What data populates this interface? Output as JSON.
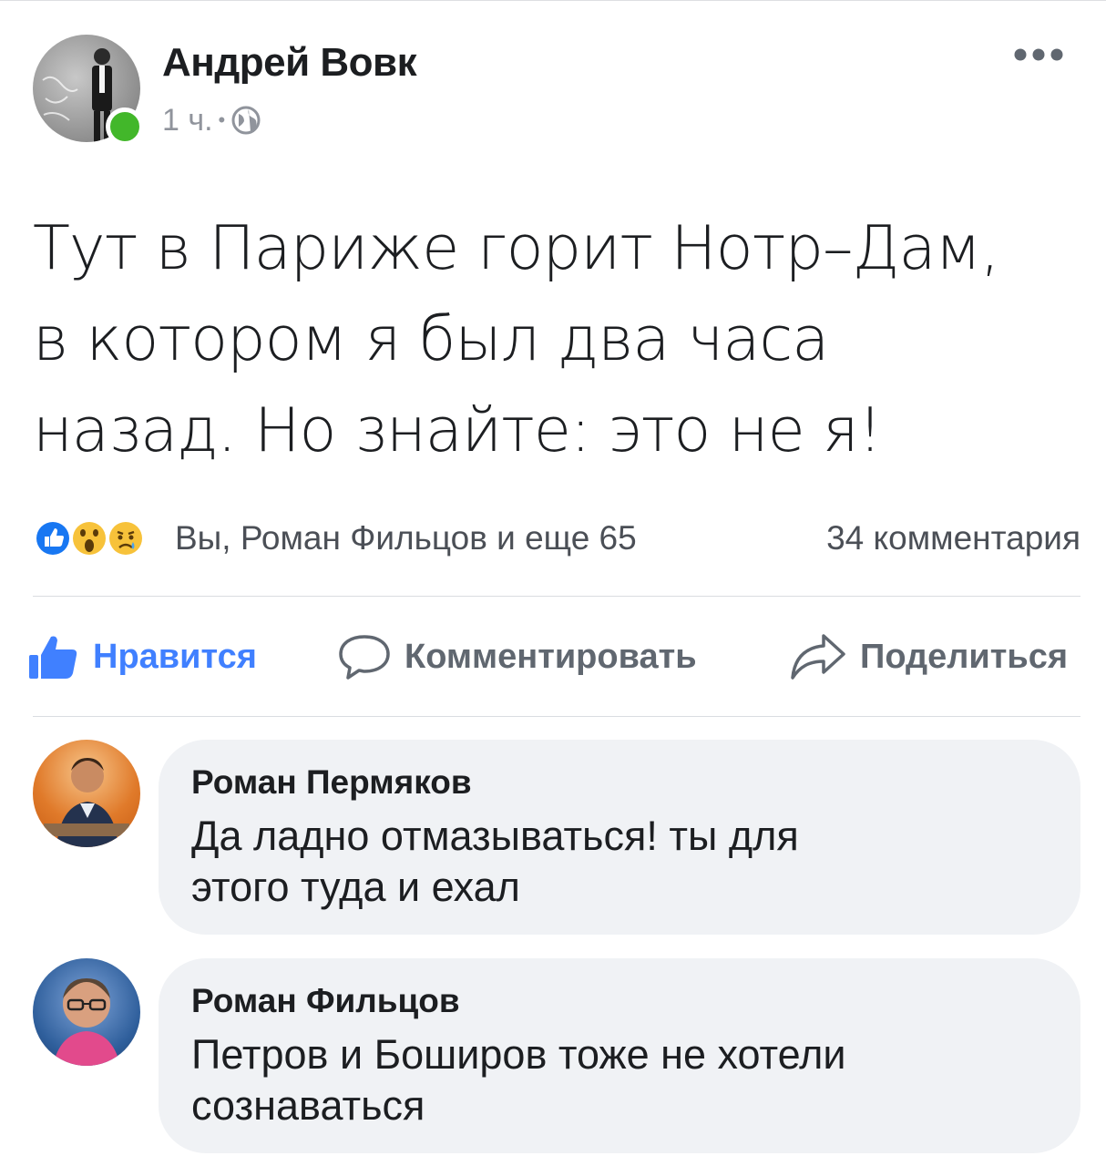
{
  "post": {
    "author": "Андрей Вовк",
    "time": "1 ч.",
    "separator": "•",
    "privacy_icon": "globe-icon",
    "more_icon": "more-horizontal-icon",
    "text_lines": [
      "Тут в Париже горит Нотр–Дам,",
      "в котором я был два часа",
      "назад. Но знайте: это не я!"
    ]
  },
  "reactions": {
    "icons": [
      "like-reaction-icon",
      "wow-reaction-icon",
      "sad-reaction-icon"
    ],
    "summary": "Вы, Роман Фильцов и еще 65",
    "comments_count": "34 комментария"
  },
  "actions": {
    "like_label": "Нравится",
    "comment_label": "Комментировать",
    "share_label": "Поделиться"
  },
  "comments": [
    {
      "author": "Роман Пермяков",
      "text_lines": [
        "Да ладно отмазываться! ты для",
        "этого туда и ехал"
      ]
    },
    {
      "author": "Роман Фильцов",
      "text_lines": [
        "Петров и Боширов тоже не хотели",
        "сознаваться"
      ]
    }
  ],
  "colors": {
    "accent": "#4080ff",
    "online": "#42b72a",
    "bubble": "#f0f2f5",
    "muted": "#90949c"
  }
}
